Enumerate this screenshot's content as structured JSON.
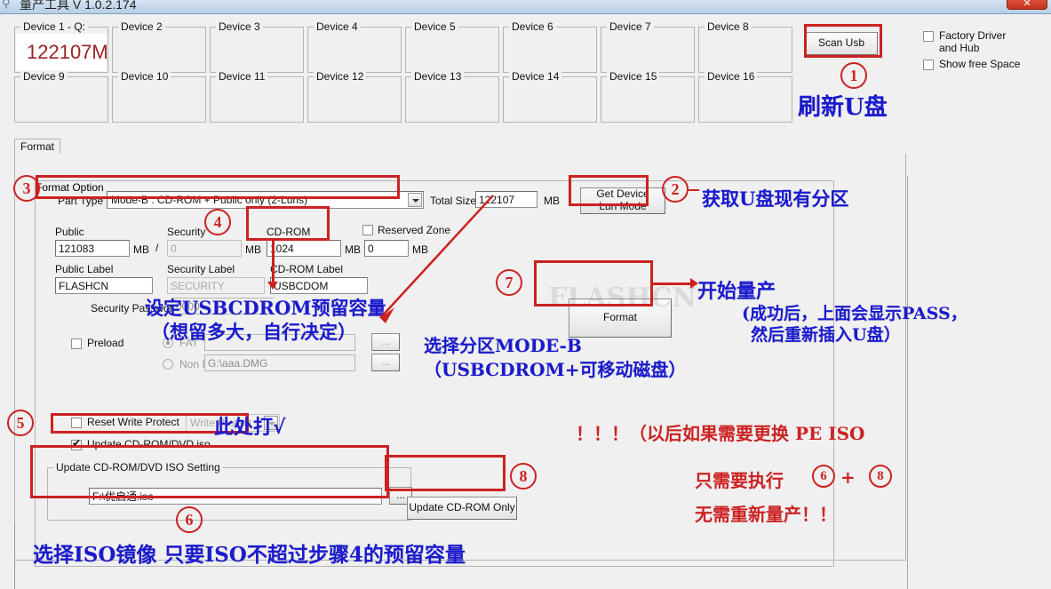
{
  "window": {
    "title": "量产工具 V 1.0.2.174",
    "title_icon": "usb-tool-icon",
    "close_label": "✕"
  },
  "devices": {
    "slot_labels": [
      "Device 1 - Q:",
      "Device 2",
      "Device 3",
      "Device 4",
      "Device 5",
      "Device 6",
      "Device 7",
      "Device 8",
      "Device 9",
      "Device 10",
      "Device 11",
      "Device 12",
      "Device 13",
      "Device 14",
      "Device 15",
      "Device 16"
    ],
    "device1_size": "122107M",
    "device1_size_color": "#9b2222"
  },
  "toolbar": {
    "scan_usb_label": "Scan Usb",
    "factory_driver_label_line1": "Factory Driver",
    "factory_driver_label_line2": "and Hub",
    "factory_driver_checked": false,
    "show_free_space_label": "Show free Space",
    "show_free_space_checked": false
  },
  "tabs": {
    "format_tab": "Format"
  },
  "format_option": {
    "group_caption": "Format Option",
    "part_type_label": "Part Type",
    "part_type_value": "Mode-B : CD-ROM + Public only   (2-Luns)",
    "total_size_label": "Total Size",
    "total_size_value": "122107",
    "total_size_unit": "MB",
    "get_lun_mode_label_line1": "Get Device",
    "get_lun_mode_label_line2": "Lun Mode",
    "public_label": "Public",
    "public_value": "121083",
    "public_unit": "MB",
    "slash": "/",
    "security_label": "Security",
    "security_value": "0",
    "security_unit": "MB",
    "cdrom_label": "CD-ROM",
    "cdrom_value": "1024",
    "cdrom_unit": "MB",
    "reserved_zone_label": "Reserved Zone",
    "reserved_zone_checked": false,
    "reserved_zone_value": "0",
    "reserved_zone_unit": "MB",
    "public_label_label": "Public Label",
    "public_label_value": "FLASHCN",
    "security_label_label": "Security Label",
    "security_label_value": "SECURITY",
    "cdrom_label_label": "CD-ROM Label",
    "cdrom_label_value": "USBCDOM",
    "security_password_label": "Security Password",
    "security_password_value": "0000",
    "preload_label": "Preload",
    "preload_checked": false,
    "fat_label": "FAT",
    "fat_selected": true,
    "nonfat_label": "Non FAT",
    "nonfat_selected": false,
    "preload_path_fat": "",
    "preload_path_nonfat": "G:\\aaa.DMG",
    "browse_label": "...",
    "format_button_label": "Format",
    "reset_write_protect_label": "Reset Write Protect",
    "reset_write_protect_checked": false,
    "write_protect_value": "Write Protect",
    "update_iso_label": "Update CD-ROM/DVD iso",
    "update_iso_checked": true
  },
  "iso_setting": {
    "group_caption": "Update CD-ROM/DVD ISO Setting",
    "iso_path": "F:\\优启通.iso",
    "browse_label": "...",
    "update_cdrom_only_label": "Update CD-ROM Only"
  },
  "watermark": "FLASHCN",
  "annotations": {
    "markers": [
      "1",
      "2",
      "3",
      "4",
      "5",
      "6",
      "7",
      "8"
    ],
    "step1_text": "刷新U盘",
    "step2_text": "获取U盘现有分区",
    "step4_text_line1": "设定USBCDROM预留容量",
    "step4_text_line2": "（想留多大，自行决定）",
    "step3_text_line1": "选择分区MODE-B",
    "step3_text_line2": "（USBCDROM+可移动磁盘）",
    "step7_text_line1": "开始量产",
    "step7_text_line2": "(成功后，上面会显示PASS，",
    "step7_text_line3": "然后重新插入U盘）",
    "step5_text": "此处打√",
    "warn_line1": "！！！（以后如果需要更换 PE ISO",
    "warn_line2_a": "只需要执行",
    "warn_line2_b": "+",
    "warn_line3": "无需重新量产！！",
    "step6_text": "选择ISO镜像 只要ISO不超过步骤4的预留容量",
    "accent_red": "#cc2222",
    "accent_blue": "#1a1ad0"
  }
}
